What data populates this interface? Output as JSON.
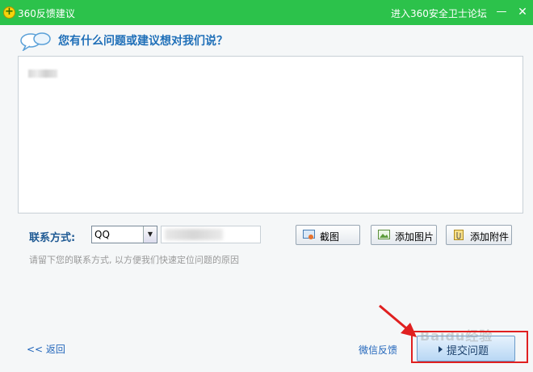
{
  "titlebar": {
    "logo_glyph": "+",
    "title": "360反馈建议",
    "forum_link": "进入360安全卫士论坛",
    "minimize_glyph": "—",
    "close_glyph": "✕"
  },
  "main": {
    "prompt": "您有什么问题或建议想对我们说？",
    "feedback_text": ""
  },
  "contact": {
    "label": "联系方式:",
    "select_value": "QQ",
    "input_value": "",
    "hint": "请留下您的联系方式, 以方便我们快速定位问题的原因"
  },
  "toolbar": {
    "screenshot_label": "截图",
    "add_image_label": "添加图片",
    "add_attachment_label": "添加附件"
  },
  "footer": {
    "back_label": "<< 返回",
    "wechat_label": "微信反馈",
    "submit_label": "提交问题"
  },
  "watermark": "Baidu经验",
  "colors": {
    "titlebar": "#2cc24b",
    "prompt": "#1f6fb8",
    "annotation": "#e02020"
  }
}
